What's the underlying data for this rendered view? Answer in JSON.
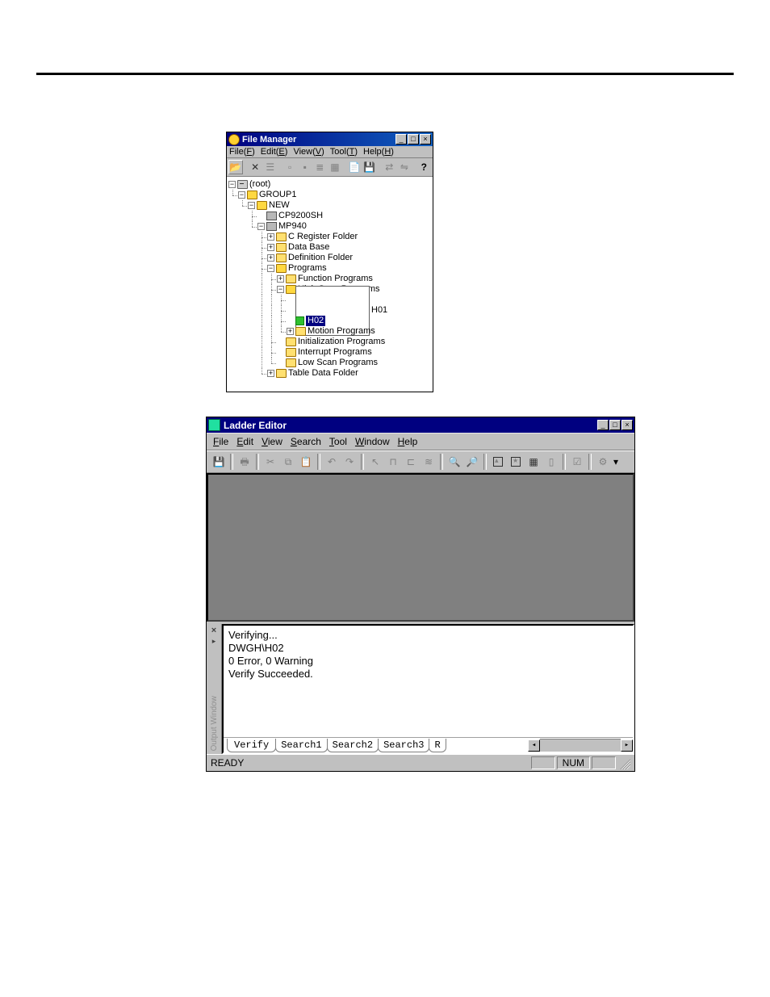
{
  "file_manager": {
    "title": "File Manager",
    "menu": {
      "file": "File(F)",
      "edit": "Edit(E)",
      "view": "View(V)",
      "tool": "Tool(T)",
      "help": "Help(H)"
    },
    "win_buttons": {
      "min": "_",
      "max": "□",
      "close": "×"
    },
    "tree": {
      "root": "(root)",
      "group": "GROUP1",
      "new": "NEW",
      "cp": "CP9200SH",
      "mp": "MP940",
      "creg": "C Register Folder",
      "db": "Data Base",
      "deff": "Definition Folder",
      "progs": "Programs",
      "funcp": "Function Programs",
      "hsp": "High Scan Programs",
      "h": "H",
      "h01": "H01",
      "h02": "H02",
      "motion": "Motion Programs",
      "initp": "Initialization Programs",
      "intp": "Interrupt Programs",
      "lowp": "Low Scan Programs",
      "tdf": "Table Data Folder"
    }
  },
  "ladder_editor": {
    "title": "Ladder Editor",
    "menu": {
      "file": "File",
      "edit": "Edit",
      "view": "View",
      "search": "Search",
      "tool": "Tool",
      "window": "Window",
      "help": "Help"
    },
    "win_buttons": {
      "min": "_",
      "max": "□",
      "close": "×"
    },
    "output": {
      "close": "×",
      "vert_label": "Output Window",
      "lines": [
        "Verifying...",
        "DWGH\\H02",
        "0 Error, 0 Warning",
        "Verify Succeeded."
      ],
      "l1": "Verifying...",
      "l2": "DWGH\\H02",
      "l3": "0 Error, 0 Warning",
      "l4": "Verify Succeeded.",
      "tabs": {
        "verify": "Verify",
        "s1": "Search1",
        "s2": "Search2",
        "s3": "Search3",
        "s4": "R"
      },
      "scroll_left": "◂",
      "scroll_right": "▸"
    },
    "status": {
      "ready": "READY",
      "num": "NUM"
    }
  }
}
